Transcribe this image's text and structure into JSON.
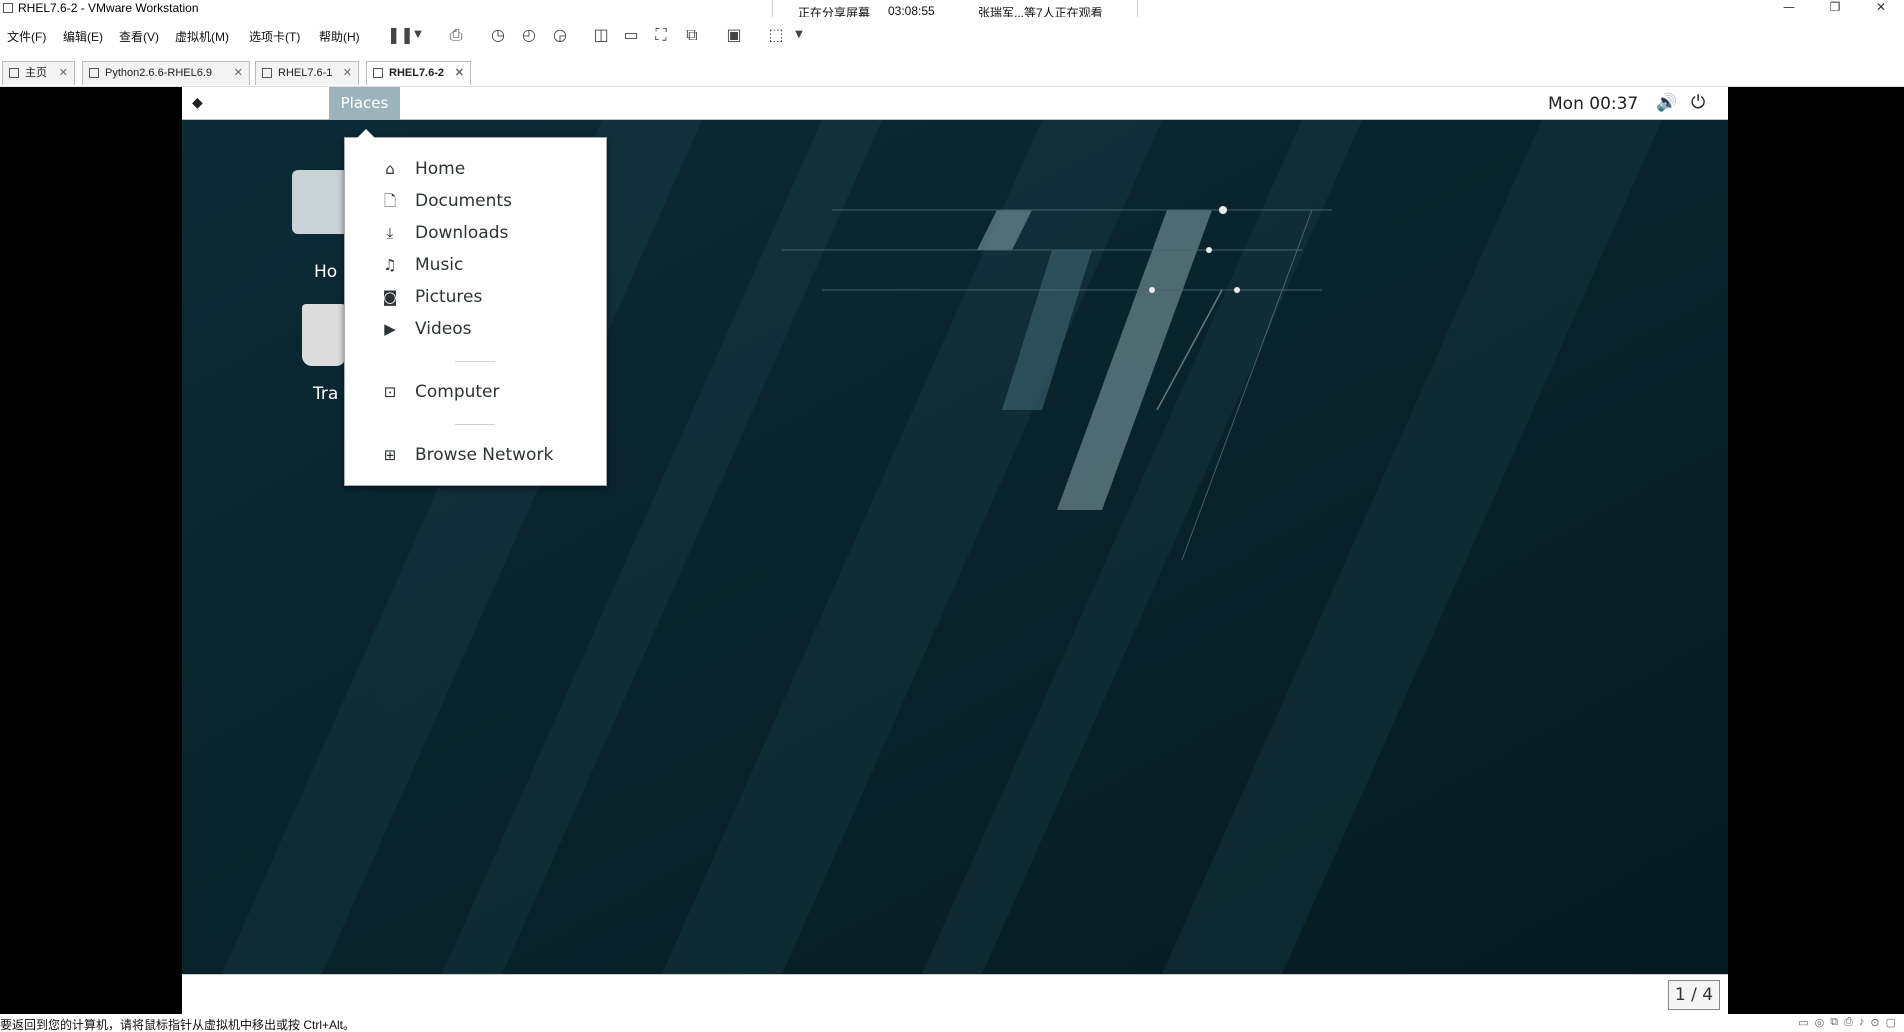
{
  "window": {
    "title": "RHEL7.6-2 - VMware Workstation",
    "controls": [
      "—",
      "❐",
      "✕"
    ]
  },
  "share_banner": {
    "status": "正在分享屏幕",
    "time": "03:08:55",
    "viewers": "张瑞军...等7人正在观看"
  },
  "menubar": {
    "items": [
      "文件(F)",
      "编辑(E)",
      "查看(V)",
      "虚拟机(M)",
      "选项卡(T)",
      "帮助(H)"
    ]
  },
  "tabs": [
    {
      "label": "主页"
    },
    {
      "label": "Python2.6.6-RHEL6.9"
    },
    {
      "label": "RHEL7.6-1"
    },
    {
      "label": "RHEL7.6-2"
    }
  ],
  "gnome": {
    "places_label": "Places",
    "clock": "Mon 00:37"
  },
  "desktop": {
    "home_label": "Ho",
    "trash_label": "Tra"
  },
  "places_menu": {
    "items": [
      {
        "label": "Home",
        "icon": "home-icon"
      },
      {
        "label": "Documents",
        "icon": "document-icon"
      },
      {
        "label": "Downloads",
        "icon": "download-icon"
      },
      {
        "label": "Music",
        "icon": "music-icon"
      },
      {
        "label": "Pictures",
        "icon": "camera-icon"
      },
      {
        "label": "Videos",
        "icon": "video-icon"
      },
      {
        "label": "Computer",
        "icon": "computer-icon"
      },
      {
        "label": "Browse Network",
        "icon": "network-icon"
      }
    ]
  },
  "workspace": "1 / 4",
  "statusbar": {
    "message": "要返回到您的计算机，请将鼠标指针从虚拟机中移出或按 Ctrl+Alt。"
  },
  "colors": {
    "desktop_bg": "#0a2630",
    "places_active": "#9cb3bb"
  }
}
